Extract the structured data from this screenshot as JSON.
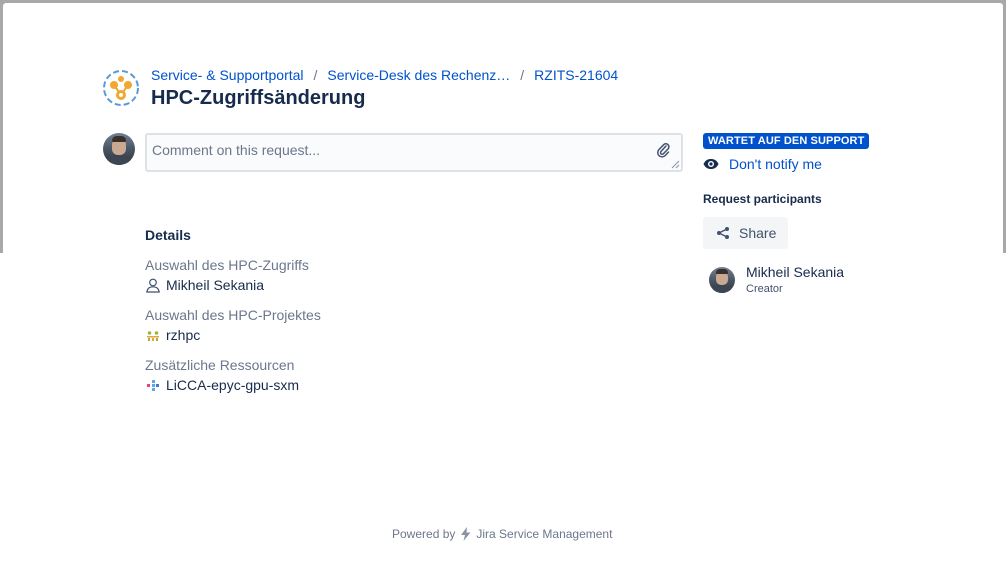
{
  "breadcrumb": {
    "items": [
      "Service- & Supportportal",
      "Service-Desk des Rechenz…",
      "RZITS-21604"
    ],
    "separator": "/"
  },
  "page": {
    "title": "HPC-Zugriffsänderung"
  },
  "comment": {
    "placeholder": "Comment on this request..."
  },
  "details": {
    "heading": "Details",
    "fields": [
      {
        "label": "Auswahl des HPC-Zugriffs",
        "value": "Mikheil Sekania",
        "icon": "user-icon"
      },
      {
        "label": "Auswahl des HPC-Projektes",
        "value": "rzhpc",
        "icon": "project-icon"
      },
      {
        "label": "Zusätzliche Ressourcen",
        "value": "LiCCA-epyc-gpu-sxm",
        "icon": "resource-icon"
      }
    ]
  },
  "sidebar": {
    "status": "WARTET AUF DEN SUPPORT",
    "notify_label": "Don't notify me",
    "participants_heading": "Request participants",
    "share_label": "Share",
    "participant": {
      "name": "Mikheil Sekania",
      "role": "Creator"
    }
  },
  "footer": {
    "powered_by": "Powered by",
    "product": "Jira Service Management"
  },
  "colors": {
    "link": "#0052cc",
    "status_badge": "#0052cc",
    "text": "#172b4d",
    "muted": "#6b778c"
  }
}
